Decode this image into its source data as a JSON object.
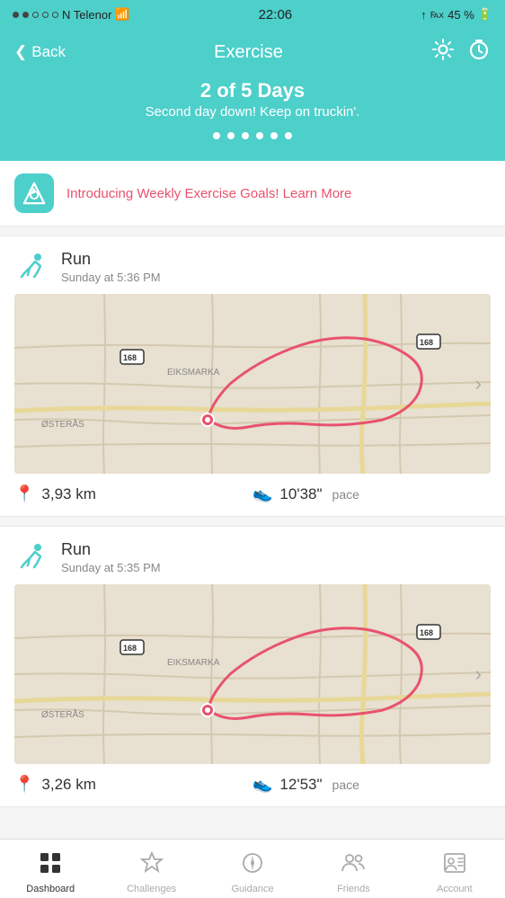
{
  "statusBar": {
    "signal": "●●○○○",
    "carrier": "N Telenor",
    "wifi": true,
    "time": "22:06",
    "location": true,
    "bluetooth": true,
    "battery": "45 %"
  },
  "header": {
    "back_label": "Back",
    "title": "Exercise",
    "gear_icon": "⚙",
    "timer_icon": "⏱"
  },
  "banner": {
    "days": "2 of 5 Days",
    "subtitle": "Second day down! Keep on truckin'.",
    "dots": [
      false,
      true,
      true,
      true,
      true,
      true
    ]
  },
  "promo": {
    "text": "Introducing Weekly Exercise Goals!",
    "link": "Learn More"
  },
  "runs": [
    {
      "type": "Run",
      "time": "Sunday at 5:36 PM",
      "distance": "3,93 km",
      "pace": "10'38\"",
      "pace_label": "pace"
    },
    {
      "type": "Run",
      "time": "Sunday at 5:35 PM",
      "distance": "3,26 km",
      "pace": "12'53\"",
      "pace_label": "pace"
    }
  ],
  "bottomNav": {
    "items": [
      {
        "label": "Dashboard",
        "icon": "grid",
        "active": true
      },
      {
        "label": "Challenges",
        "icon": "star",
        "active": false
      },
      {
        "label": "Guidance",
        "icon": "compass",
        "active": false
      },
      {
        "label": "Friends",
        "icon": "people",
        "active": false
      },
      {
        "label": "Account",
        "icon": "person-card",
        "active": false
      }
    ]
  }
}
